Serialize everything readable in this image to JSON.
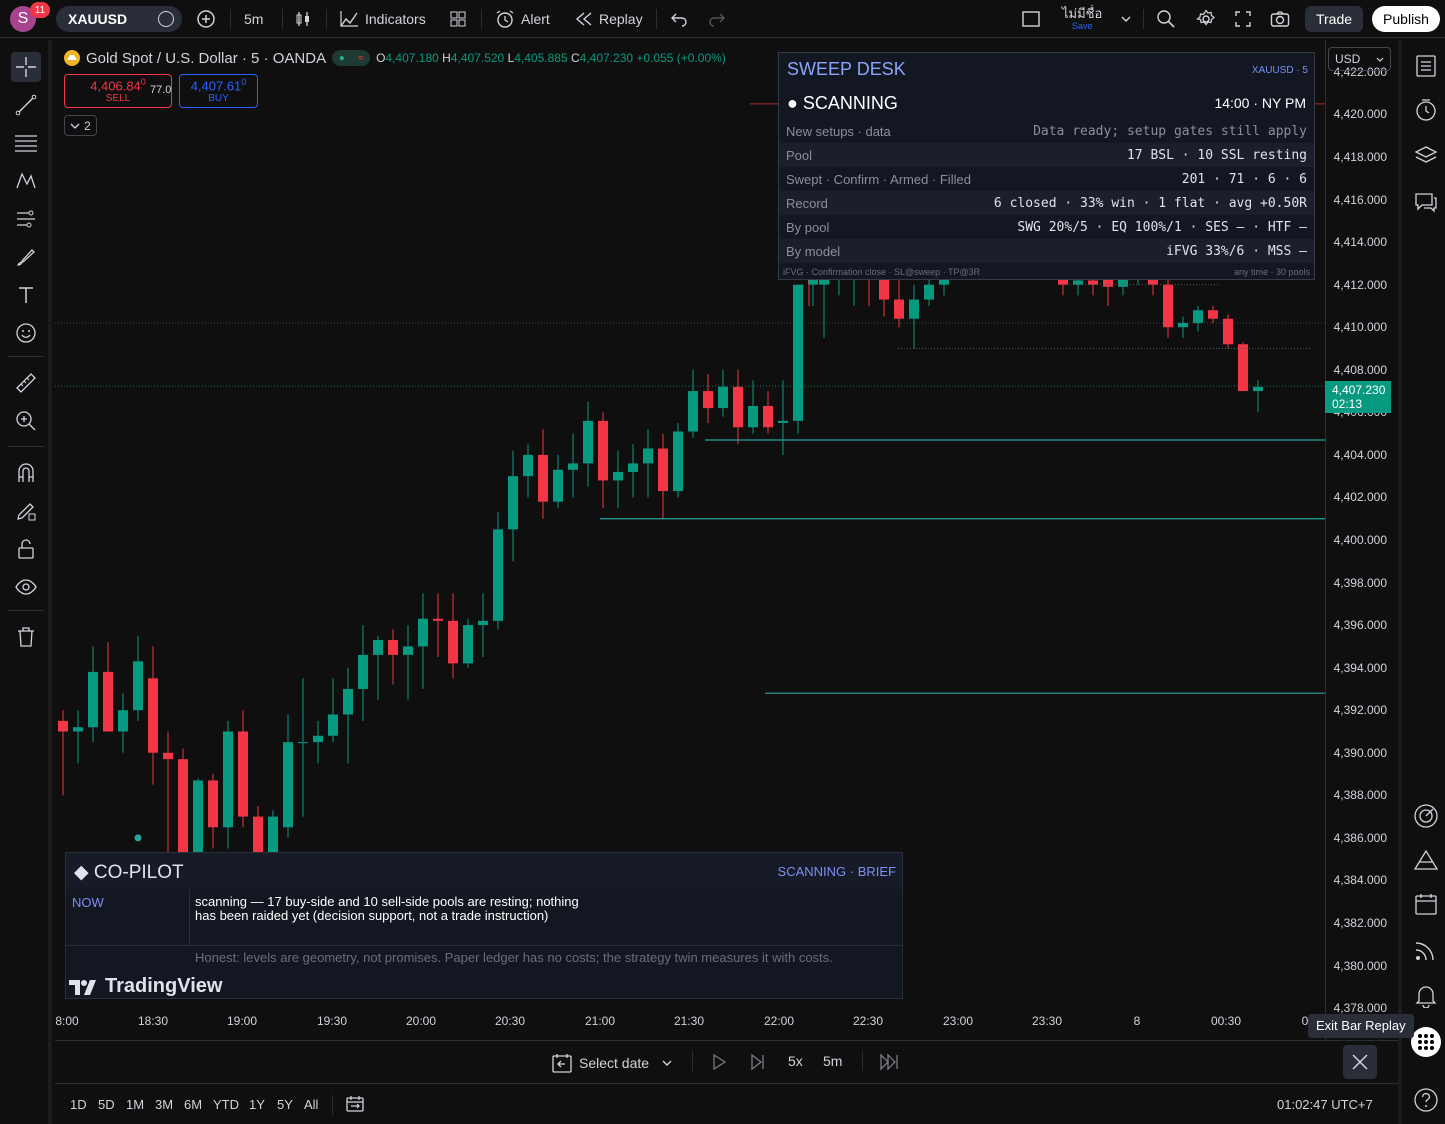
{
  "topbar": {
    "avatar_letter": "S",
    "notif_count": "11",
    "symbol": "XAUUSD",
    "interval": "5m",
    "indicators": "Indicators",
    "alert": "Alert",
    "replay": "Replay",
    "layout_name": "ไม่มีชื่อ",
    "layout_save": "Save",
    "trade": "Trade",
    "publish": "Publish"
  },
  "legend": {
    "title": "Gold Spot / U.S. Dollar · 5 · OANDA",
    "o_label": "O",
    "o": "4,407.180",
    "h_label": "H",
    "h": "4,407.520",
    "l_label": "L",
    "l": "4,405.885",
    "c_label": "C",
    "c": "4,407.230",
    "chg": "+0.055 (+0.00%)",
    "sell_price": "4,406.84",
    "sell_sup": "0",
    "sell": "SELL",
    "spread": "77.0",
    "buy_price": "4,407.61",
    "buy_sup": "0",
    "buy": "BUY",
    "indicator_count": "2"
  },
  "sweep_desk": {
    "title": "SWEEP DESK",
    "symbol": "XAUUSD · 5",
    "status": "● SCANNING",
    "time": "14:00 · NY PM",
    "rows": [
      {
        "label": "New setups · data",
        "value": "Data ready; setup gates still apply"
      },
      {
        "label": "Pool",
        "value": "17 BSL · 10 SSL resting"
      },
      {
        "label": "Swept · Confirm · Armed · Filled",
        "value": "201 · 71 · 6 · 6"
      },
      {
        "label": "Record",
        "value": "6 closed · 33% win · 1 flat · avg +0.50R"
      },
      {
        "label": "By pool",
        "value": "SWG 20%/5 · EQ 100%/1 · SES — · HTF —"
      },
      {
        "label": "By model",
        "value": "iFVG 33%/6 · MSS —"
      }
    ],
    "footer_left": "iFVG · Confirmation close · SL@sweep · TP@3R",
    "footer_right": "any time · 30 pools"
  },
  "copilot": {
    "title": "◆ CO-PILOT",
    "right": "SCANNING · BRIEF",
    "now_label": "NOW",
    "now_text": "scanning — 17 buy-side and 10 sell-side pools are resting; nothing has been raided yet (decision support, not a trade instruction)",
    "honest": "Honest: levels are geometry, not promises. Paper ledger has no costs; the strategy twin measures it with costs.",
    "logo": "TradingView"
  },
  "price_axis": {
    "currency": "USD",
    "ticks": [
      "4,422.000",
      "4,420.000",
      "4,418.000",
      "4,416.000",
      "4,414.000",
      "4,412.000",
      "4,410.000",
      "4,408.000",
      "4,406.000",
      "4,404.000",
      "4,402.000",
      "4,400.000",
      "4,398.000",
      "4,396.000",
      "4,394.000",
      "4,392.000",
      "4,390.000",
      "4,388.000",
      "4,386.000",
      "4,384.000",
      "4,382.000",
      "4,380.000",
      "4,378.000"
    ],
    "last_price": "4,407.230",
    "countdown": "02:13"
  },
  "time_axis": {
    "ticks": [
      "8:00",
      "18:30",
      "19:00",
      "19:30",
      "20:00",
      "20:30",
      "21:00",
      "21:30",
      "22:00",
      "22:30",
      "23:00",
      "23:30",
      "8",
      "00:30",
      "0"
    ]
  },
  "replay_bar": {
    "select_date": "Select date",
    "speed": "5x",
    "interval": "5m",
    "exit_tooltip": "Exit Bar Replay"
  },
  "range_bar": {
    "ranges": [
      "1D",
      "5D",
      "1M",
      "3M",
      "6M",
      "YTD",
      "1Y",
      "5Y",
      "All"
    ],
    "clock": "01:02:47 UTC+7"
  },
  "colors": {
    "up": "#089981",
    "down": "#f23645",
    "accent": "#2962ff",
    "panel_title": "#8ba5ff"
  },
  "chart_data": {
    "type": "candlestick",
    "ylim": [
      4376.5,
      4423.5
    ],
    "candles": [
      [
        4391.5,
        4392.0,
        4388.0,
        4391.0
      ],
      [
        4391.0,
        4392.0,
        4389.5,
        4391.2
      ],
      [
        4391.2,
        4395.0,
        4390.5,
        4393.8
      ],
      [
        4393.8,
        4395.2,
        4391.0,
        4391.0
      ],
      [
        4391.0,
        4392.8,
        4390.0,
        4392.0
      ],
      [
        4392.0,
        4395.5,
        4391.5,
        4394.3
      ],
      [
        4393.5,
        4395.0,
        4388.5,
        4390.0
      ],
      [
        4390.0,
        4391.0,
        4385.0,
        4389.7
      ],
      [
        4389.7,
        4390.2,
        4383.0,
        4384.0
      ],
      [
        4384.0,
        4388.8,
        4383.5,
        4388.7
      ],
      [
        4388.7,
        4389.0,
        4385.5,
        4386.5
      ],
      [
        4386.5,
        4391.5,
        4385.5,
        4391.0
      ],
      [
        4391.0,
        4392.0,
        4386.5,
        4387.0
      ],
      [
        4387.0,
        4387.5,
        4385.0,
        4385.0
      ],
      [
        4385.0,
        4387.3,
        4384.8,
        4387.0
      ],
      [
        4386.5,
        4391.8,
        4386.0,
        4390.5
      ],
      [
        4390.5,
        4393.5,
        4387.0,
        4390.5
      ],
      [
        4390.5,
        4391.5,
        4389.5,
        4390.8
      ],
      [
        4390.8,
        4393.5,
        4390.5,
        4391.8
      ],
      [
        4391.8,
        4394.0,
        4389.5,
        4393.0
      ],
      [
        4393.0,
        4396.0,
        4391.5,
        4394.6
      ],
      [
        4394.6,
        4395.5,
        4392.5,
        4395.3
      ],
      [
        4395.3,
        4395.8,
        4393.2,
        4394.6
      ],
      [
        4394.6,
        4396.0,
        4392.5,
        4395.0
      ],
      [
        4395.0,
        4397.5,
        4393.0,
        4396.3
      ],
      [
        4396.3,
        4397.5,
        4394.5,
        4396.2
      ],
      [
        4396.2,
        4397.5,
        4393.5,
        4394.2
      ],
      [
        4394.2,
        4396.3,
        4394.0,
        4396.0
      ],
      [
        4396.0,
        4397.5,
        4394.5,
        4396.2
      ],
      [
        4396.2,
        4401.3,
        4395.8,
        4400.5
      ],
      [
        4400.5,
        4404.2,
        4399.0,
        4403.0
      ],
      [
        4403.0,
        4404.5,
        4402.0,
        4404.0
      ],
      [
        4404.0,
        4405.2,
        4401.0,
        4401.8
      ],
      [
        4401.8,
        4404.0,
        4401.5,
        4403.3
      ],
      [
        4403.3,
        4405.0,
        4402.0,
        4403.6
      ],
      [
        4403.6,
        4406.5,
        4402.5,
        4405.6
      ],
      [
        4405.6,
        4406.0,
        4401.5,
        4402.8
      ],
      [
        4402.8,
        4404.2,
        4401.5,
        4403.2
      ],
      [
        4403.2,
        4404.5,
        4402.0,
        4403.6
      ],
      [
        4403.6,
        4405.2,
        4402.0,
        4404.3
      ],
      [
        4404.3,
        4405.0,
        4401.0,
        4402.3
      ],
      [
        4402.3,
        4405.5,
        4402.0,
        4405.1
      ],
      [
        4405.1,
        4408.0,
        4404.8,
        4407.0
      ],
      [
        4407.0,
        4407.8,
        4405.5,
        4406.2
      ],
      [
        4406.2,
        4408.0,
        4405.8,
        4407.2
      ],
      [
        4407.2,
        4408.0,
        4404.5,
        4405.3
      ],
      [
        4405.3,
        4407.5,
        4405.0,
        4406.3
      ],
      [
        4406.3,
        4407.0,
        4405.0,
        4405.3
      ],
      [
        4405.5,
        4407.5,
        4404.0,
        4405.6
      ],
      [
        4405.6,
        4412.0,
        4405.0,
        4412.0
      ],
      [
        4412.0,
        4414.0,
        4411.0,
        4414.0
      ],
      [
        4414.0,
        4417.0,
        4413.5,
        4416.7
      ],
      [
        4416.7,
        4418.0,
        4415.5,
        4415.9
      ],
      [
        4415.9,
        4418.0,
        4412.5,
        4413.2
      ]
    ],
    "candles_right": [
      [
        4413.2,
        4414.0,
        4411.0,
        4412.5
      ],
      [
        4412.0,
        4413.5,
        4409.5,
        4412.5
      ],
      [
        4412.8,
        4414.0,
        4411.5,
        4413.0
      ],
      [
        4412.5,
        4414.5,
        4411.0,
        4412.5
      ],
      [
        4412.5,
        4414.0,
        4411.0,
        4412.3
      ],
      [
        4412.8,
        4413.0,
        4410.5,
        4411.3
      ],
      [
        4411.3,
        4412.5,
        4410.0,
        4410.4
      ],
      [
        4410.4,
        4412.0,
        4409.0,
        4411.3
      ],
      [
        4411.3,
        4412.5,
        4411.0,
        4412.0
      ],
      [
        4412.0,
        4413.0,
        4411.5,
        4412.3
      ]
    ],
    "candles_far_right": [
      [
        4412.3,
        4413.0,
        4411.5,
        4412.0
      ],
      [
        4412.0,
        4413.0,
        4411.5,
        4412.2
      ],
      [
        4412.2,
        4413.0,
        4411.5,
        4412.0
      ],
      [
        4412.5,
        4413.0,
        4411.0,
        4411.9
      ],
      [
        4411.9,
        4413.0,
        4411.5,
        4412.3
      ],
      [
        4412.3,
        4413.0,
        4412.0,
        4412.5
      ],
      [
        4412.5,
        4413.0,
        4411.5,
        4412.0
      ],
      [
        4412.0,
        4412.5,
        4409.5,
        4410.0
      ],
      [
        4410.0,
        4410.5,
        4409.5,
        4410.2
      ],
      [
        4410.2,
        4411.0,
        4409.8,
        4410.8
      ],
      [
        4410.8,
        4411.0,
        4410.2,
        4410.4
      ],
      [
        4410.4,
        4410.6,
        4409.0,
        4409.2
      ],
      [
        4409.2,
        4409.3,
        4407.0,
        4407.0
      ],
      [
        4407.0,
        4407.5,
        4406.0,
        4407.2
      ]
    ],
    "levels": [
      4404.7,
      4401.0,
      4392.8
    ],
    "last_price": 4407.23
  }
}
